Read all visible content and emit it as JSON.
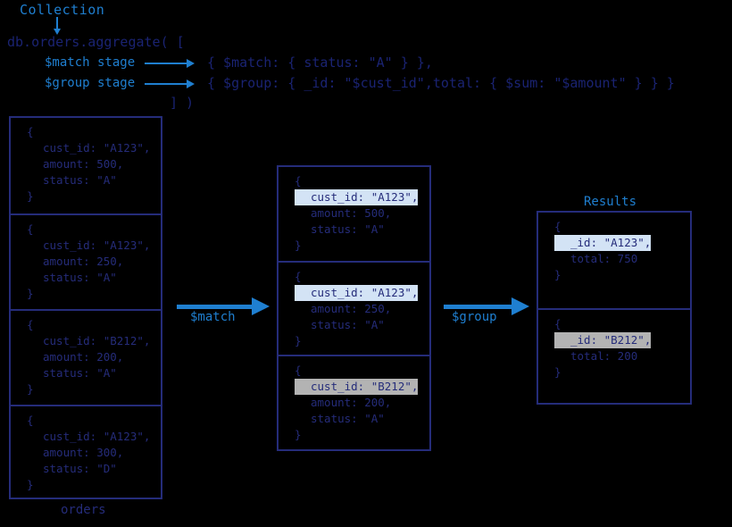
{
  "header": {
    "collection_label": "Collection",
    "code_line_1": "db.orders.aggregate( [",
    "stage_match_label": "$match stage",
    "stage_group_label": "$group stage",
    "code_line_2": "{ $match: { status: \"A\" } },",
    "code_line_3": "{ $group: { _id: \"$cust_id\",total: { $sum: \"$amount\" } } }",
    "code_line_4": "] )"
  },
  "colors": {
    "background": "#000000",
    "accent_blue": "#1f7fd0",
    "code_navy": "#1a2372",
    "document_navy": "#252c7a",
    "highlight_blue": "#d3e3f5",
    "highlight_gray": "#b3b3b3"
  },
  "orders_collection": {
    "label": "orders",
    "documents": [
      {
        "open": "{",
        "cust_id": "cust_id: \"A123\",",
        "amount": "amount: 500,",
        "status": "status: \"A\"",
        "close": "}"
      },
      {
        "open": "{",
        "cust_id": "cust_id: \"A123\",",
        "amount": "amount: 250,",
        "status": "status: \"A\"",
        "close": "}"
      },
      {
        "open": "{",
        "cust_id": "cust_id: \"B212\",",
        "amount": "amount: 200,",
        "status": "status: \"A\"",
        "close": "}"
      },
      {
        "open": "{",
        "cust_id": "cust_id: \"A123\",",
        "amount": "amount: 300,",
        "status": "status: \"D\"",
        "close": "}"
      }
    ]
  },
  "matched_documents": {
    "documents": [
      {
        "open": "{",
        "cust_id": "cust_id: \"A123\",",
        "amount": "amount: 500,",
        "status": "status: \"A\"",
        "close": "}",
        "highlight": "blue"
      },
      {
        "open": "{",
        "cust_id": "cust_id: \"A123\",",
        "amount": "amount: 250,",
        "status": "status: \"A\"",
        "close": "}",
        "highlight": "blue"
      },
      {
        "open": "{",
        "cust_id": "cust_id: \"B212\",",
        "amount": "amount: 200,",
        "status": "status: \"A\"",
        "close": "}",
        "highlight": "gray"
      }
    ]
  },
  "results": {
    "label": "Results",
    "documents": [
      {
        "open": "{",
        "id": "_id: \"A123\",",
        "total": "total: 750",
        "close": "}",
        "highlight": "blue"
      },
      {
        "open": "{",
        "id": "_id: \"B212\",",
        "total": "total: 200",
        "close": "}",
        "highlight": "gray"
      }
    ]
  },
  "flow": {
    "match_label": "$match",
    "group_label": "$group"
  }
}
